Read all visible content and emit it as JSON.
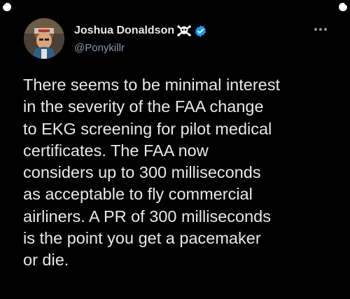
{
  "tweet": {
    "author": {
      "display_name": "Joshua Donaldson",
      "handle": "@Ponykillr",
      "name_emoji": "skull-and-crossbones-icon",
      "verified": true,
      "verified_color": "#1d9bf0"
    },
    "more_icon": "more-horizontal-icon",
    "text_lines": [
      "There seems to be minimal interest",
      "in the severity of the FAA change",
      "to EKG screening for pilot medical",
      "certificates. The FAA now",
      "considers up to 300 milliseconds",
      "as acceptable to fly commercial",
      "airliners. A PR of 300 milliseconds",
      "is the point you get a pacemaker",
      "or die."
    ]
  },
  "colors": {
    "background": "#000000",
    "text_primary": "#e7e9ea",
    "text_secondary": "#8b98a5"
  }
}
